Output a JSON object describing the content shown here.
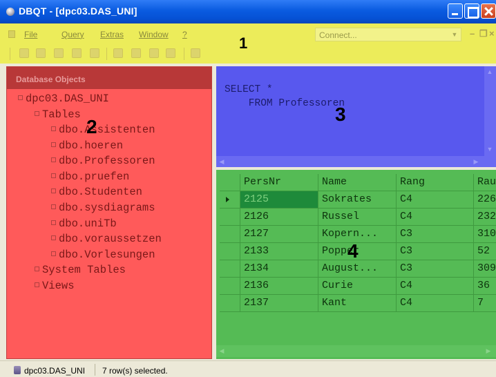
{
  "window": {
    "title": "DBQT - [dpc03.DAS_UNI]"
  },
  "menubar": {
    "items": [
      "File",
      "Query",
      "Extras",
      "Window",
      "?"
    ],
    "connect_placeholder": "Connect..."
  },
  "zone_labels": [
    "1",
    "2",
    "3",
    "4"
  ],
  "database_objects": {
    "header": "Database Objects",
    "root": "dpc03.DAS_UNI",
    "tables_label": "Tables",
    "tables": [
      "dbo.Assistenten",
      "dbo.hoeren",
      "dbo.Professoren",
      "dbo.pruefen",
      "dbo.Studenten",
      "dbo.sysdiagrams",
      "dbo.uniTb",
      "dbo.voraussetzen",
      "dbo.Vorlesungen"
    ],
    "system_tables_label": "System Tables",
    "views_label": "Views"
  },
  "query_editor": {
    "sql_line1": "SELECT *",
    "sql_line2": "    FROM Professoren"
  },
  "results": {
    "columns": [
      "PersNr",
      "Name",
      "Rang",
      "Rau"
    ],
    "rows": [
      [
        "2125",
        "Sokrates",
        "C4",
        "226"
      ],
      [
        "2126",
        "Russel",
        "C4",
        "232"
      ],
      [
        "2127",
        "Kopern...",
        "C3",
        "310"
      ],
      [
        "2133",
        "Popper",
        "C3",
        "52"
      ],
      [
        "2134",
        "August...",
        "C3",
        "309"
      ],
      [
        "2136",
        "Curie",
        "C4",
        "36"
      ],
      [
        "2137",
        "Kant",
        "C4",
        "7"
      ]
    ]
  },
  "statusbar": {
    "connection": "dpc03.DAS_UNI",
    "message": "7 row(s) selected."
  }
}
